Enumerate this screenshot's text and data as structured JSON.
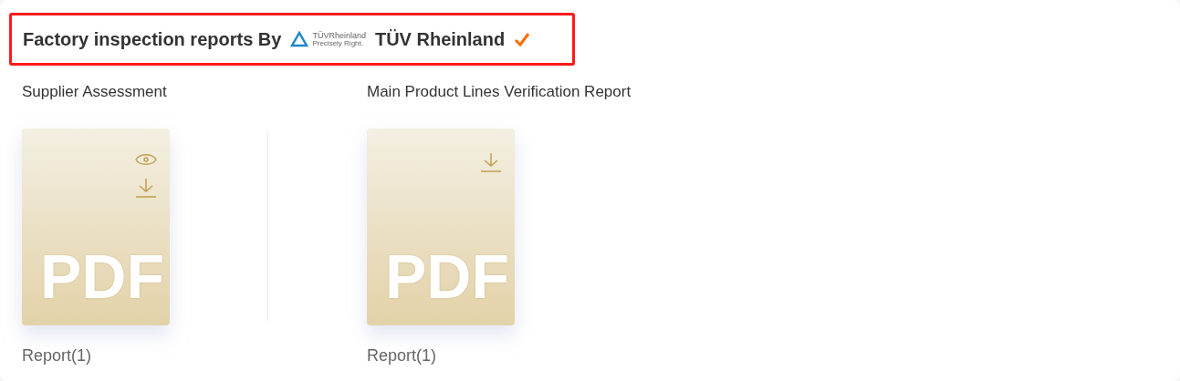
{
  "header": {
    "title": "Factory inspection reports By",
    "logo": {
      "wordmark": "TÜVRheinland",
      "tagline": "Precisely Right."
    },
    "brand": "TÜV Rheinland",
    "verified": true
  },
  "reports": [
    {
      "name": "Supplier Assessment",
      "file_label": "PDF",
      "actions": [
        {
          "kind": "view"
        },
        {
          "kind": "download"
        }
      ],
      "caption": "Report(1)"
    },
    {
      "name": "Main Product Lines Verification Report",
      "file_label": "PDF",
      "actions": [
        {
          "kind": "download"
        }
      ],
      "caption": "Report(1)"
    }
  ]
}
